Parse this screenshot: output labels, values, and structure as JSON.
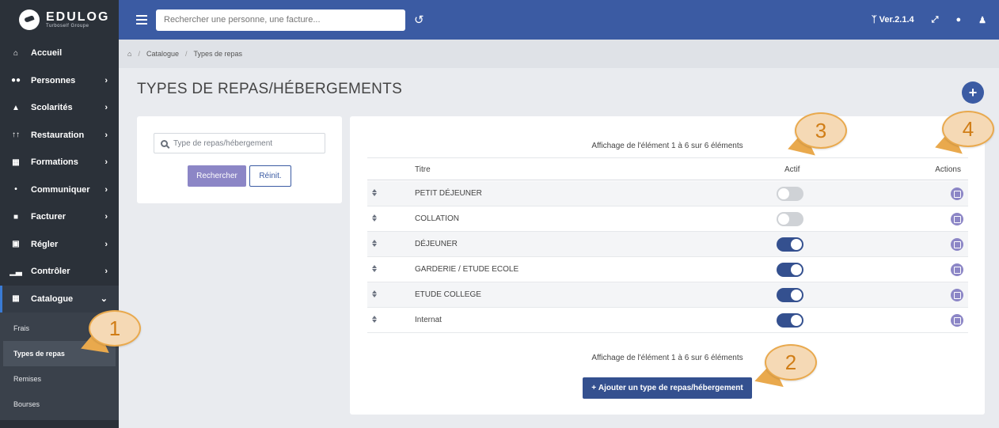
{
  "brand": {
    "name": "EDULOG",
    "subtitle": "Turboself Groupe"
  },
  "topbar": {
    "search_placeholder": "Rechercher une personne, une facture...",
    "version": "Ver.2.1.4"
  },
  "sidebar": {
    "items": [
      {
        "label": "Accueil",
        "icon": "home-icon"
      },
      {
        "label": "Personnes",
        "icon": "users-icon"
      },
      {
        "label": "Scolarités",
        "icon": "graduation-icon"
      },
      {
        "label": "Restauration",
        "icon": "utensils-icon"
      },
      {
        "label": "Formations",
        "icon": "school-icon"
      },
      {
        "label": "Communiquer",
        "icon": "broadcast-icon"
      },
      {
        "label": "Facturer",
        "icon": "invoice-icon"
      },
      {
        "label": "Régler",
        "icon": "money-icon"
      },
      {
        "label": "Contrôler",
        "icon": "chart-icon"
      },
      {
        "label": "Catalogue",
        "icon": "catalog-icon"
      }
    ],
    "sub_items": [
      "Frais",
      "Types de repas",
      "Remises",
      "Bourses"
    ]
  },
  "breadcrumb": {
    "home": "home-icon",
    "items": [
      "Catalogue",
      "Types de repas"
    ]
  },
  "page": {
    "title": "TYPES DE REPAS/HÉBERGEMENTS"
  },
  "filter": {
    "placeholder": "Type de repas/hébergement",
    "search_label": "Rechercher",
    "reset_label": "Réinit."
  },
  "table": {
    "info": "Affichage de l'élément 1 à 6 sur 6 éléments",
    "columns": {
      "title": "Titre",
      "active": "Actif",
      "actions": "Actions"
    },
    "rows": [
      {
        "title": "PETIT DÉJEUNER",
        "active": false
      },
      {
        "title": "COLLATION",
        "active": false
      },
      {
        "title": "DÉJEUNER",
        "active": true
      },
      {
        "title": "GARDERIE / ETUDE ECOLE",
        "active": true
      },
      {
        "title": "ETUDE COLLEGE",
        "active": true
      },
      {
        "title": "Internat",
        "active": true
      }
    ],
    "add_label": "Ajouter un type de repas/hébergement"
  },
  "callouts": [
    "1",
    "2",
    "3",
    "4"
  ],
  "colors": {
    "topbar": "#3b5ba3",
    "sidebar": "#2b3139",
    "accent": "#8c86c6",
    "toggle_on": "#34508f",
    "callout": "#e9a94d"
  }
}
